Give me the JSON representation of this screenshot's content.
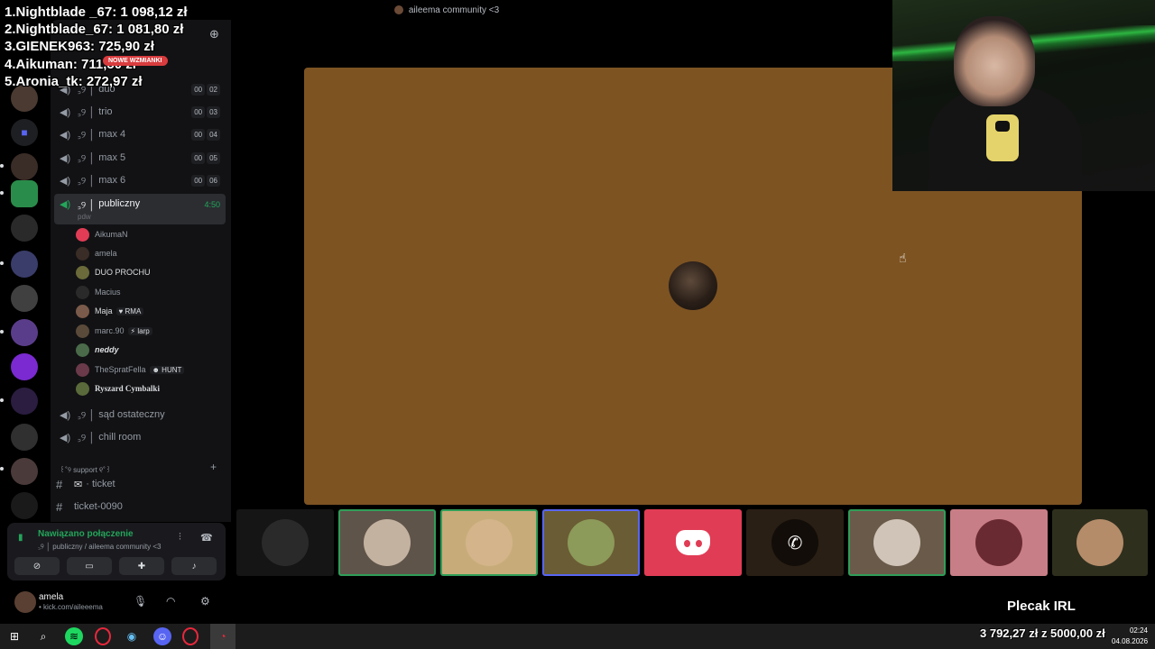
{
  "window": {
    "title": "aileema community <3"
  },
  "leaderboard": [
    "1.Nightblade _67: 1 098,12 zł",
    "2.Nightblade_67: 1 081,80 zł",
    "3.GIENEK963: 725,90 zł",
    "4.Aikuman: 711,50 zł",
    "5.Aronia_tk: 272,97 zł"
  ],
  "server_header": {
    "name": "aileema community <3",
    "mentions_badge": "NOWE WZMIANKI"
  },
  "voice_channels": [
    {
      "label": "duo",
      "users": "00",
      "limit": "02"
    },
    {
      "label": "trio",
      "users": "00",
      "limit": "03"
    },
    {
      "label": "max 4",
      "users": "00",
      "limit": "04"
    },
    {
      "label": "max 5",
      "users": "00",
      "limit": "05"
    },
    {
      "label": "max 6",
      "users": "00",
      "limit": "06"
    }
  ],
  "channel_symbol": "꜆୨ │",
  "active_channel": {
    "label": "publiczny",
    "duration": "4:50",
    "subtitle": "pdw"
  },
  "members": [
    {
      "name": "AikumaN",
      "tag": ""
    },
    {
      "name": "amela",
      "tag": ""
    },
    {
      "name": "DUO PROCHU",
      "tag": ""
    },
    {
      "name": "Macius",
      "tag": ""
    },
    {
      "name": "Maja",
      "tag": "RMA"
    },
    {
      "name": "marc.90",
      "tag": "larp"
    },
    {
      "name": "neddy",
      "tag": ""
    },
    {
      "name": "TheSpratFella",
      "tag": "HUNT"
    },
    {
      "name": "Ryszard Cymbalki",
      "tag": ""
    }
  ],
  "more_voice_channels": [
    {
      "label": "sąd ostateczny"
    },
    {
      "label": "chill room"
    }
  ],
  "category": "꒰˚୨ support ୧˚꒱",
  "text_channels": [
    {
      "label": "· ticket"
    },
    {
      "label": "ticket-0090"
    }
  ],
  "voice_status": {
    "title": "Nawiązano połączenie",
    "location": "꜆୨ │ publiczny / aileema community <3"
  },
  "user": {
    "name": "amela",
    "status": "• kick.com/aileeema"
  },
  "goal": {
    "title": "Plecak IRL",
    "value": "3 792,27 zł z 5000,00 zł"
  },
  "clock": {
    "time": "02:24",
    "date": "04.08.2026"
  },
  "icons": [
    "speaker-icon",
    "add-friend-icon",
    "hash-icon",
    "signal-icon",
    "soundwave-icon",
    "hangup-icon",
    "camera-off-icon",
    "screen-share-icon",
    "activities-icon",
    "soundboard-icon",
    "mic-icon",
    "headphones-icon",
    "settings-icon",
    "discord-logo-icon",
    "phone-icon",
    "cursor-icon",
    "windows-start-icon",
    "search-icon",
    "spotify-icon",
    "opera-icon",
    "steam-icon",
    "discord-icon"
  ],
  "colors": {
    "stage": "#7d5322",
    "online": "#23a55a",
    "discord_red": "#e13c55",
    "mentions_badge": "#d83c3e"
  }
}
